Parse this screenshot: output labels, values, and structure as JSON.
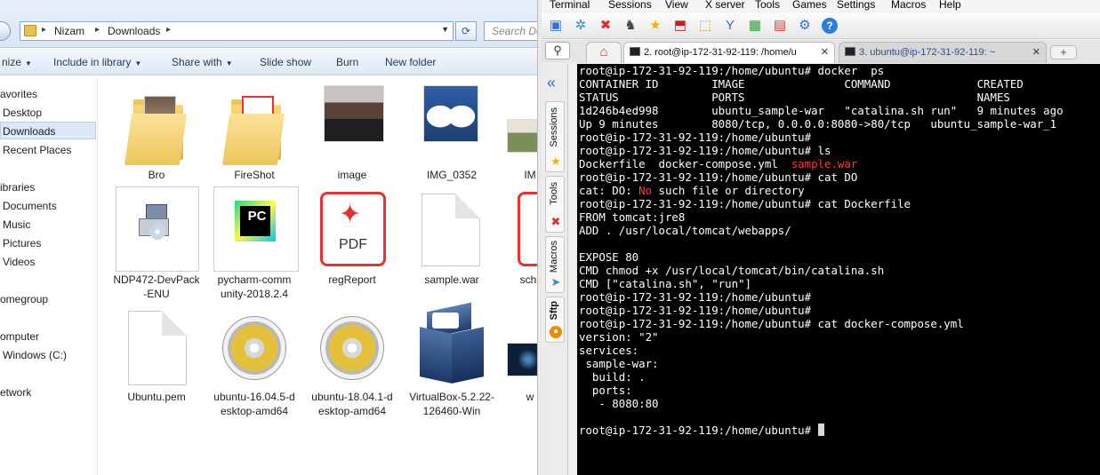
{
  "explorer": {
    "breadcrumb": [
      "Nizam",
      "Downloads"
    ],
    "search_placeholder": "Search Do",
    "toolbar": [
      "nize",
      "Include in library",
      "Share with",
      "Slide show",
      "Burn",
      "New folder"
    ],
    "nav": [
      "avorites",
      "Desktop",
      "Downloads",
      "Recent Places",
      "ibraries",
      "Documents",
      "Music",
      "Pictures",
      "Videos",
      "omegroup",
      "omputer",
      "Windows (C:)",
      "etwork"
    ],
    "files": [
      {
        "name": "Bro",
        "kind": "folder-photo"
      },
      {
        "name": "FireShot",
        "kind": "folder-pdf"
      },
      {
        "name": "image",
        "kind": "photo"
      },
      {
        "name": "IMG_0352",
        "kind": "photo-shoes"
      },
      {
        "name": "IM",
        "kind": "photo-field"
      },
      {
        "name": "NDP472-DevPack\n-ENU",
        "kind": "installer"
      },
      {
        "name": "pycharm-comm\nunity-2018.2.4",
        "kind": "pycharm"
      },
      {
        "name": "regReport",
        "kind": "pdf"
      },
      {
        "name": "sample.war",
        "kind": "file"
      },
      {
        "name": "sch",
        "kind": "pdf"
      },
      {
        "name": "Ubuntu.pem",
        "kind": "file"
      },
      {
        "name": "ubuntu-16.04.5-d\nesktop-amd64",
        "kind": "disc"
      },
      {
        "name": "ubuntu-18.04.1-d\nesktop-amd64",
        "kind": "disc"
      },
      {
        "name": "VirtualBox-5.2.22-\n126460-Win",
        "kind": "virtualbox"
      },
      {
        "name": "w",
        "kind": "photo-dark"
      }
    ],
    "pdf_label": "PDF",
    "pycharm_label": "PC"
  },
  "mobaxterm": {
    "menu": [
      "Terminal",
      "Sessions",
      "View",
      "X server",
      "Tools",
      "Games",
      "Settings",
      "Macros",
      "Help"
    ],
    "tabs": [
      {
        "label": "2. root@ip-172-31-92-119: /home/u",
        "active": true
      },
      {
        "label": "3. ubuntu@ip-172-31-92-119: ~",
        "active": false
      }
    ],
    "sidebar_tabs": [
      "Sessions",
      "Tools",
      "Macros",
      "Sftp"
    ],
    "terminal_lines": [
      [
        {
          "t": "root@ip-172-31-92-119:/home/ubuntu# docker  ps"
        }
      ],
      [
        {
          "t": "CONTAINER ID        IMAGE               COMMAND             CREATED"
        }
      ],
      [
        {
          "t": "STATUS              PORTS                                   NAMES"
        }
      ],
      [
        {
          "t": "1d246b4ed998        ubuntu_sample-war   \"catalina.sh run\"   9 minutes ago"
        }
      ],
      [
        {
          "t": "Up 9 minutes        8080/tcp, 0.0.0.0:8080->80/tcp   ubuntu_sample-war_1"
        }
      ],
      [
        {
          "t": "root@ip-172-31-92-119:/home/ubuntu#"
        }
      ],
      [
        {
          "t": "root@ip-172-31-92-119:/home/ubuntu# ls"
        }
      ],
      [
        {
          "t": "Dockerfile  docker-compose.yml  "
        },
        {
          "t": "sample.war",
          "c": "red"
        }
      ],
      [
        {
          "t": "root@ip-172-31-92-119:/home/ubuntu# cat DO"
        }
      ],
      [
        {
          "t": "cat: DO: "
        },
        {
          "t": "No",
          "c": "red"
        },
        {
          "t": " such file or directory"
        }
      ],
      [
        {
          "t": "root@ip-172-31-92-119:/home/ubuntu# cat Dockerfile"
        }
      ],
      [
        {
          "t": "FROM tomcat:jre8"
        }
      ],
      [
        {
          "t": "ADD . /usr/local/tomcat/webapps/"
        }
      ],
      [
        {
          "t": ""
        }
      ],
      [
        {
          "t": "EXPOSE 80"
        }
      ],
      [
        {
          "t": "CMD chmod +x /usr/local/tomcat/bin/catalina.sh"
        }
      ],
      [
        {
          "t": "CMD [\"catalina.sh\", \"run\"]"
        }
      ],
      [
        {
          "t": "root@ip-172-31-92-119:/home/ubuntu#"
        }
      ],
      [
        {
          "t": "root@ip-172-31-92-119:/home/ubuntu#"
        }
      ],
      [
        {
          "t": "root@ip-172-31-92-119:/home/ubuntu# cat docker-compose.yml"
        }
      ],
      [
        {
          "t": "version: \"2\""
        }
      ],
      [
        {
          "t": "services:"
        }
      ],
      [
        {
          "t": " sample-war:"
        }
      ],
      [
        {
          "t": "  build: ."
        }
      ],
      [
        {
          "t": "  ports:"
        }
      ],
      [
        {
          "t": "   - 8080:80"
        }
      ],
      [
        {
          "t": ""
        }
      ],
      [
        {
          "t": "root@ip-172-31-92-119:/home/ubuntu# "
        }
      ]
    ]
  }
}
